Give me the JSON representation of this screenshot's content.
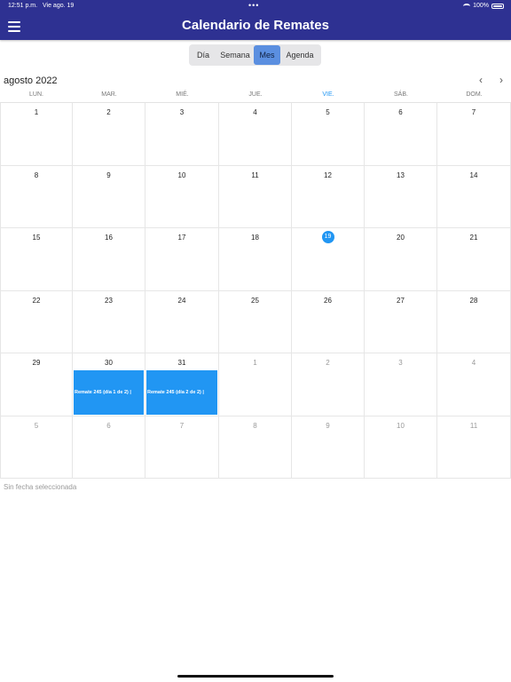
{
  "status": {
    "time": "12:51 p.m.",
    "date": "Vie ago. 19",
    "dots": "•••",
    "battery": "100%"
  },
  "header": {
    "title": "Calendario de Remates"
  },
  "segments": [
    {
      "label": "Día",
      "active": false
    },
    {
      "label": "Semana",
      "active": false
    },
    {
      "label": "Mes",
      "active": true
    },
    {
      "label": "Agenda",
      "active": false
    }
  ],
  "month": {
    "label": "agosto 2022",
    "prev": "‹",
    "next": "›"
  },
  "weekdays": [
    "LUN.",
    "MAR.",
    "MIÉ.",
    "JUE.",
    "VIE.",
    "SÁB.",
    "DOM."
  ],
  "today_weekday_index": 4,
  "weeks": [
    [
      {
        "d": "1"
      },
      {
        "d": "2"
      },
      {
        "d": "3"
      },
      {
        "d": "4"
      },
      {
        "d": "5"
      },
      {
        "d": "6"
      },
      {
        "d": "7"
      }
    ],
    [
      {
        "d": "8"
      },
      {
        "d": "9"
      },
      {
        "d": "10"
      },
      {
        "d": "11"
      },
      {
        "d": "12"
      },
      {
        "d": "13"
      },
      {
        "d": "14"
      }
    ],
    [
      {
        "d": "15"
      },
      {
        "d": "16"
      },
      {
        "d": "17"
      },
      {
        "d": "18"
      },
      {
        "d": "19",
        "today": true
      },
      {
        "d": "20"
      },
      {
        "d": "21"
      }
    ],
    [
      {
        "d": "22"
      },
      {
        "d": "23"
      },
      {
        "d": "24"
      },
      {
        "d": "25"
      },
      {
        "d": "26"
      },
      {
        "d": "27"
      },
      {
        "d": "28"
      }
    ],
    [
      {
        "d": "29"
      },
      {
        "d": "30",
        "event": "Remate 245 (día 1 de 2) |"
      },
      {
        "d": "31",
        "event": "Remate 245 (día 2 de 2) |"
      },
      {
        "d": "1",
        "other": true
      },
      {
        "d": "2",
        "other": true
      },
      {
        "d": "3",
        "other": true
      },
      {
        "d": "4",
        "other": true
      }
    ],
    [
      {
        "d": "5",
        "other": true
      },
      {
        "d": "6",
        "other": true
      },
      {
        "d": "7",
        "other": true
      },
      {
        "d": "8",
        "other": true
      },
      {
        "d": "9",
        "other": true
      },
      {
        "d": "10",
        "other": true
      },
      {
        "d": "11",
        "other": true
      }
    ]
  ],
  "no_date_text": "Sin fecha seleccionada",
  "colors": {
    "header": "#2e3192",
    "accent": "#2196f3",
    "segment_active": "#5b8fe0"
  }
}
